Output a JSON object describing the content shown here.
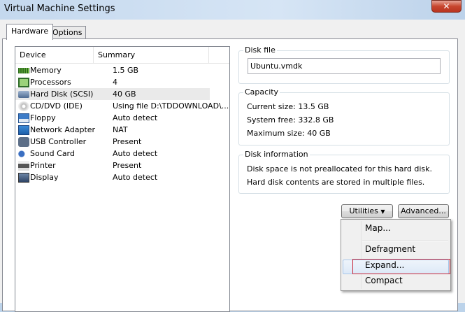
{
  "window": {
    "title": "Virtual Machine Settings",
    "close_icon": "close-icon"
  },
  "tabs": [
    {
      "label": "Hardware"
    },
    {
      "label": "Options"
    }
  ],
  "device_list": {
    "columns": [
      "Device",
      "Summary"
    ],
    "rows": [
      {
        "device": "Memory",
        "summary": "1.5 GB",
        "icon": "memory-icon"
      },
      {
        "device": "Processors",
        "summary": "4",
        "icon": "processor-icon"
      },
      {
        "device": "Hard Disk (SCSI)",
        "summary": "40 GB",
        "icon": "hard-disk-icon",
        "selected": true
      },
      {
        "device": "CD/DVD (IDE)",
        "summary": "Using file D:\\TDDOWNLOAD\\...",
        "icon": "cd-icon"
      },
      {
        "device": "Floppy",
        "summary": "Auto detect",
        "icon": "floppy-icon"
      },
      {
        "device": "Network Adapter",
        "summary": "NAT",
        "icon": "network-icon"
      },
      {
        "device": "USB Controller",
        "summary": "Present",
        "icon": "usb-icon"
      },
      {
        "device": "Sound Card",
        "summary": "Auto detect",
        "icon": "sound-icon"
      },
      {
        "device": "Printer",
        "summary": "Present",
        "icon": "printer-icon"
      },
      {
        "device": "Display",
        "summary": "Auto detect",
        "icon": "display-icon"
      }
    ]
  },
  "disk_file": {
    "label": "Disk file",
    "value": "Ubuntu.vmdk"
  },
  "capacity": {
    "label": "Capacity",
    "current": "Current size:  13.5 GB",
    "free": "System free:  332.8 GB",
    "max": "Maximum size:  40 GB"
  },
  "disk_info": {
    "label": "Disk information",
    "line1": "Disk space is not preallocated for this hard disk.",
    "line2": "Hard disk contents are stored in multiple files."
  },
  "buttons": {
    "utilities": "Utilities",
    "advanced": "Advanced..."
  },
  "menu": {
    "items": [
      "Map...",
      "Defragment",
      "Expand...",
      "Compact"
    ]
  }
}
